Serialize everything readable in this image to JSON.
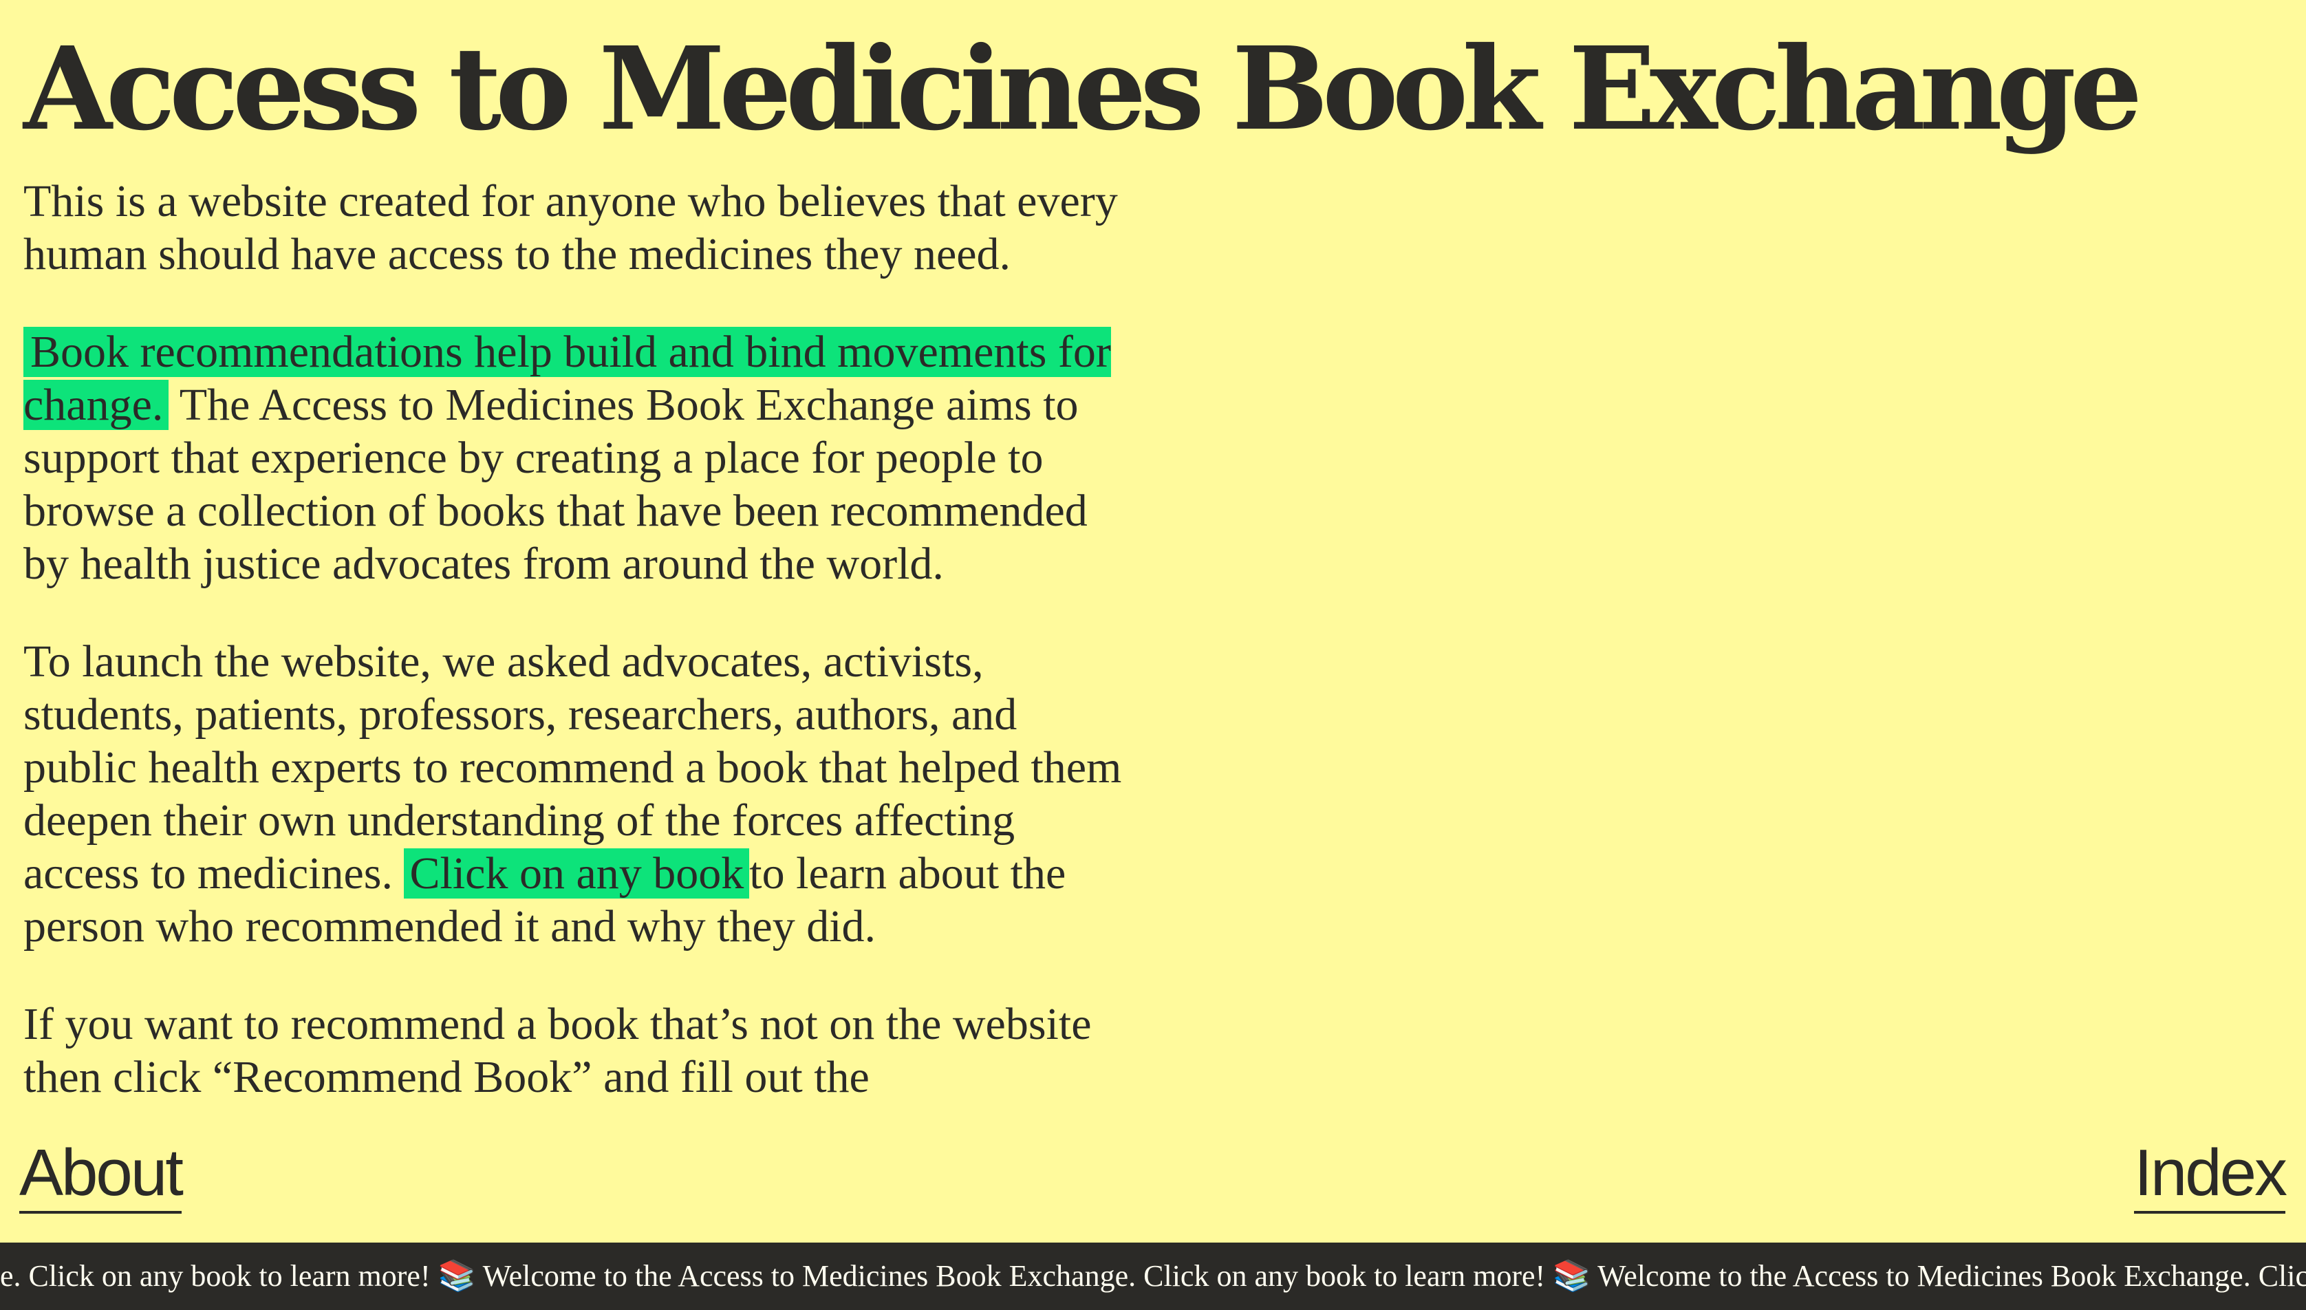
{
  "title": "Access to Medicines Book Exchange",
  "intro": {
    "p1": "This is a website created for anyone who believes that every human should have access to the medicines they need.",
    "p2_highlight": "Book recommendations help build and bind movements for change.",
    "p2_rest": " The Access to Medicines Book Exchange aims to support that experience by creating a place for people to browse a collection of books that have been recommended by health justice advocates from around the world.",
    "p3_start": "To launch the website, we asked advocates, activists, students, patients, professors, researchers, authors, and public health experts to recommend a book that helped them deepen their own understanding of the forces affecting access to medicines. ",
    "p3_highlight": "Click on any book",
    "p3_end": "to learn about the person who recommended it and why they did.",
    "p4": "If you want to recommend a book that’s not on the website then click “Recommend Book” and fill out the"
  },
  "nav": {
    "about": "About",
    "index": "Index"
  },
  "ticker": {
    "text": "e. Click on any book to learn more! 📚 Welcome to the Access to Medicines Book Exchange. Click on any book to learn more! 📚 Welcome to the Access to Medicines Book Exchange. Clic"
  }
}
